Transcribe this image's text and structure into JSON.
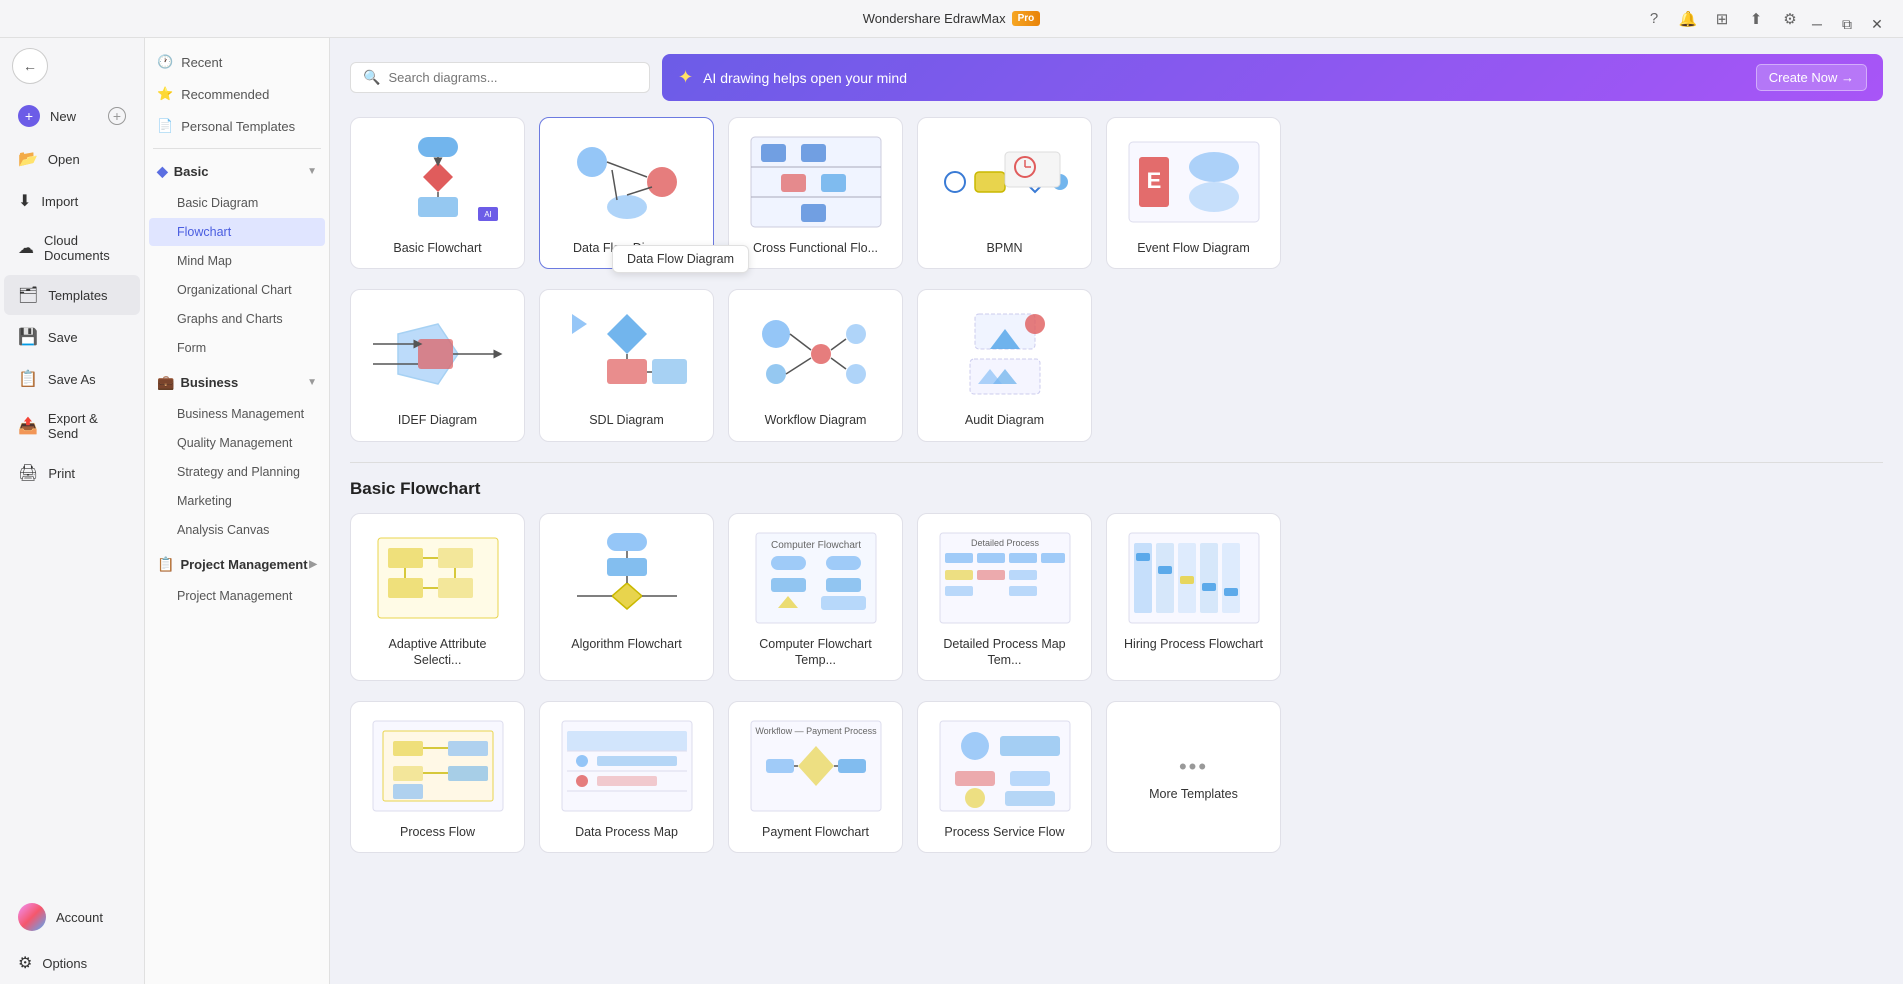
{
  "app": {
    "title": "Wondershare EdrawMax",
    "pro_badge": "Pro"
  },
  "titlebar": {
    "help_icon": "?",
    "notification_icon": "🔔",
    "apps_icon": "⊞",
    "share_icon": "↑",
    "settings_icon": "⚙"
  },
  "sidebar": {
    "back_label": "←",
    "new_label": "New",
    "open_label": "Open",
    "import_label": "Import",
    "cloud_label": "Cloud Documents",
    "templates_label": "Templates",
    "save_label": "Save",
    "saveas_label": "Save As",
    "export_label": "Export & Send",
    "print_label": "Print",
    "account_label": "Account",
    "options_label": "Options"
  },
  "category_panel": {
    "top_items": [
      {
        "label": "Recent",
        "icon": "🕐"
      },
      {
        "label": "Recommended",
        "icon": "⭐"
      },
      {
        "label": "Personal Templates",
        "icon": "📄"
      }
    ],
    "sections": [
      {
        "label": "Basic",
        "icon": "◆",
        "expanded": true,
        "items": [
          "Basic Diagram",
          "Flowchart",
          "Mind Map",
          "Organizational Chart",
          "Graphs and Charts",
          "Form"
        ]
      },
      {
        "label": "Business",
        "icon": "💼",
        "expanded": true,
        "items": [
          "Business Management",
          "Quality Management",
          "Strategy and Planning",
          "Marketing",
          "Analysis Canvas"
        ]
      },
      {
        "label": "Project Management",
        "icon": "📋",
        "expanded": false,
        "items": [
          "Project Management"
        ]
      }
    ]
  },
  "search": {
    "placeholder": "Search diagrams..."
  },
  "ai_banner": {
    "icon": "✦",
    "text": "AI drawing helps open your mind",
    "button": "Create Now →"
  },
  "flowchart_templates": [
    {
      "label": "Basic Flowchart",
      "ai": false,
      "shape": "basic_flowchart"
    },
    {
      "label": "Data Flow Diagram",
      "ai": false,
      "shape": "data_flow"
    },
    {
      "label": "Cross Functional Flo...",
      "ai": false,
      "shape": "cross_functional"
    },
    {
      "label": "BPMN",
      "ai": false,
      "shape": "bpmn"
    },
    {
      "label": "Event Flow Diagram",
      "ai": false,
      "shape": "event_flow"
    }
  ],
  "flowchart_templates2": [
    {
      "label": "IDEF Diagram",
      "shape": "idef"
    },
    {
      "label": "SDL Diagram",
      "shape": "sdl"
    },
    {
      "label": "Workflow Diagram",
      "shape": "workflow"
    },
    {
      "label": "Audit Diagram",
      "shape": "audit"
    }
  ],
  "basic_flowchart_section": {
    "title": "Basic Flowchart",
    "templates": [
      {
        "label": "Adaptive Attribute Selecti...",
        "shape": "adaptive"
      },
      {
        "label": "Algorithm Flowchart",
        "shape": "algorithm"
      },
      {
        "label": "Computer Flowchart Temp...",
        "shape": "computer"
      },
      {
        "label": "Detailed Process Map Tem...",
        "shape": "detailed"
      },
      {
        "label": "Hiring Process Flowchart",
        "shape": "hiring"
      }
    ],
    "more_label": "More Templates"
  },
  "tooltip": {
    "text": "Data Flow Diagram"
  }
}
